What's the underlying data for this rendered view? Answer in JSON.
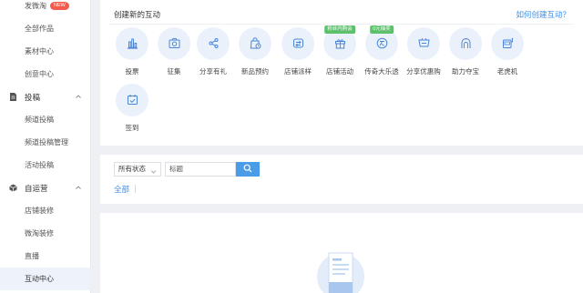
{
  "sidebar": {
    "top_items": [
      {
        "label": "发微淘",
        "badge": "NEW"
      },
      {
        "label": "全部作品"
      },
      {
        "label": "素材中心"
      },
      {
        "label": "创意中心"
      }
    ],
    "group1": {
      "label": "投稿",
      "items": [
        {
          "label": "频道投稿"
        },
        {
          "label": "频道投稿管理"
        },
        {
          "label": "活动投稿"
        }
      ]
    },
    "group2": {
      "label": "自运营",
      "items": [
        {
          "label": "店铺装修"
        },
        {
          "label": "微淘装修"
        },
        {
          "label": "直播"
        },
        {
          "label": "互动中心"
        }
      ]
    }
  },
  "create": {
    "title": "创建新的互动",
    "help_link": "如何创建互动？",
    "tools": [
      {
        "label": "投票",
        "icon": "bar-chart-icon"
      },
      {
        "label": "征集",
        "icon": "camera-icon"
      },
      {
        "label": "分享有礼",
        "icon": "share-icon"
      },
      {
        "label": "新品预约",
        "icon": "bag-clock-icon"
      },
      {
        "label": "店铺派样",
        "icon": "sample-box-icon"
      },
      {
        "label": "店铺活动",
        "icon": "gift-icon",
        "tag": "粉丝内购会"
      },
      {
        "label": "传奇大乐透",
        "icon": "lottery-icon",
        "tag": "0元抽奖"
      },
      {
        "label": "分享优惠购",
        "icon": "cart-icon"
      },
      {
        "label": "助力夺宝",
        "icon": "treasure-icon"
      },
      {
        "label": "老虎机",
        "icon": "slot-machine-icon"
      },
      {
        "label": "签到",
        "icon": "calendar-check-icon"
      }
    ]
  },
  "filter": {
    "status_select": "所有状态",
    "title_placeholder": "标题",
    "tab_all": "全部"
  },
  "colors": {
    "accent": "#3d8ee8",
    "tag_green": "#5cc16a",
    "icon_bg": "#eaf1fb",
    "new_badge": "#f25c4f"
  }
}
